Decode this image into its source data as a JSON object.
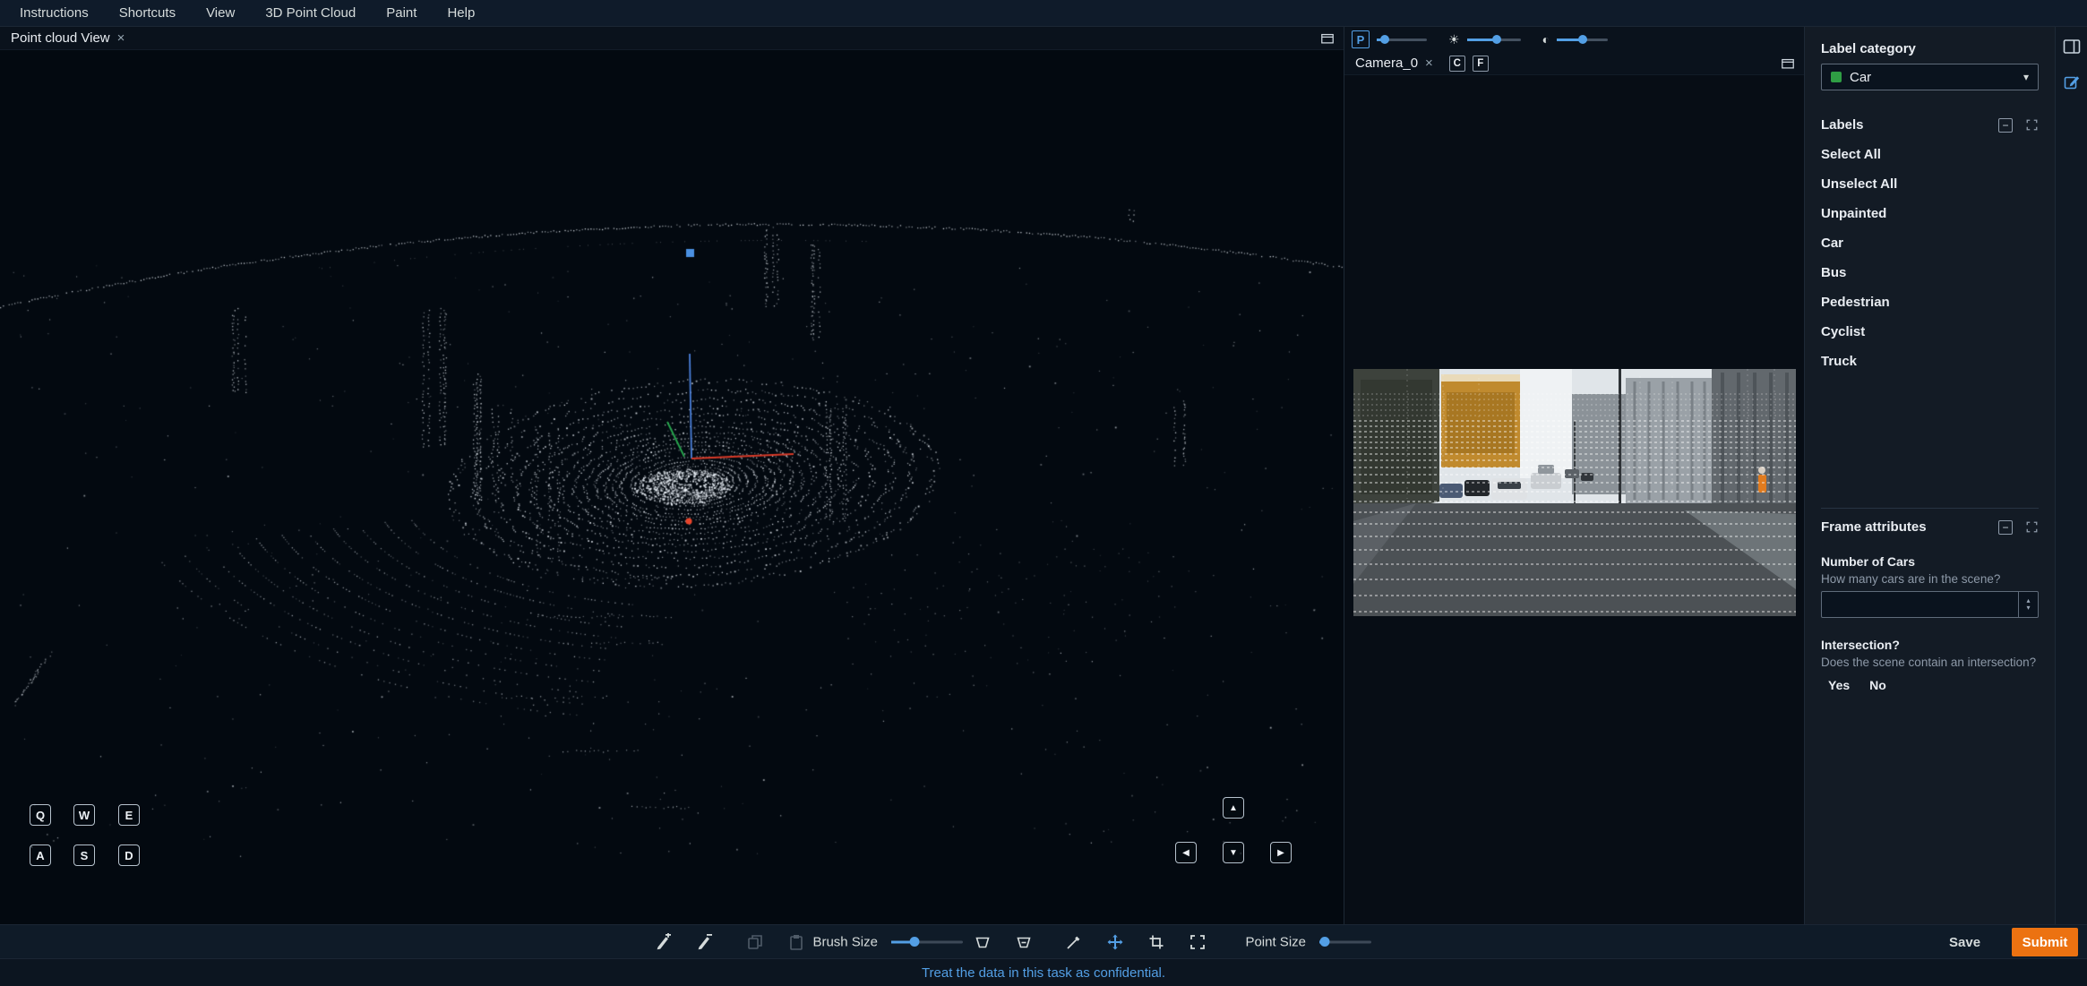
{
  "menu": {
    "items": [
      "Instructions",
      "Shortcuts",
      "View",
      "3D Point Cloud",
      "Paint",
      "Help"
    ]
  },
  "pointcloud_view": {
    "tab_title": "Point cloud View"
  },
  "camera_view": {
    "tab_title": "Camera_0",
    "c_label": "C",
    "f_label": "F"
  },
  "view_controls": {
    "p_label": "P"
  },
  "keyboard": {
    "keys": [
      "Q",
      "W",
      "E",
      "A",
      "S",
      "D"
    ]
  },
  "label_category": {
    "title": "Label category",
    "selected": "Car",
    "swatch_color": "#2f9e44"
  },
  "labels_panel": {
    "title": "Labels",
    "items": [
      "Select All",
      "Unselect All",
      "Unpainted",
      "Car",
      "Bus",
      "Pedestrian",
      "Cyclist",
      "Truck"
    ]
  },
  "frame_attributes": {
    "title": "Frame attributes",
    "number_of_cars": {
      "label": "Number of Cars",
      "question": "How many cars are in the scene?",
      "value": ""
    },
    "intersection": {
      "label": "Intersection?",
      "question": "Does the scene contain an intersection?",
      "yes": "Yes",
      "no": "No"
    }
  },
  "bottom_toolbar": {
    "brush_size_label": "Brush Size",
    "point_size_label": "Point Size",
    "save": "Save",
    "submit": "Submit"
  },
  "footer": {
    "confidential_note": "Treat the data in this task as confidential."
  },
  "icons": {
    "close": "×",
    "sun": "☀",
    "contrast": "◐",
    "caret_down": "▾",
    "minus": "−",
    "spin_up": "▴",
    "spin_down": "▾",
    "arrow_up": "▲",
    "arrow_left": "◀",
    "arrow_down": "▼",
    "arrow_right": "▶"
  },
  "colors": {
    "accent": "#539fe5",
    "submit_orange": "#ec7211",
    "label_green": "#2f9e44"
  }
}
